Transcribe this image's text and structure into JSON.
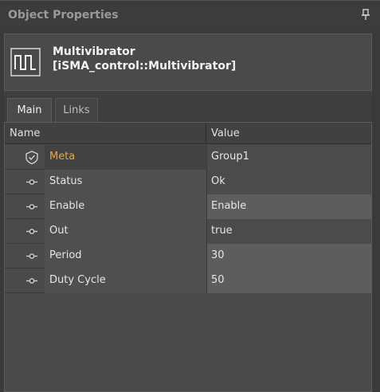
{
  "panel": {
    "title": "Object Properties",
    "pin_icon": "pin-icon"
  },
  "object": {
    "name": "Multivibrator",
    "type": "[iSMA_control::Multivibrator]",
    "icon": "multivibrator-icon"
  },
  "tabs": [
    {
      "label": "Main",
      "active": true
    },
    {
      "label": "Links",
      "active": false
    }
  ],
  "grid": {
    "columns": [
      "Name",
      "Value"
    ],
    "rows": [
      {
        "name": "Meta",
        "value": "Group1",
        "icon": "shield-icon"
      },
      {
        "name": "Status",
        "value": "Ok",
        "icon": "slot-icon"
      },
      {
        "name": "Enable",
        "value": "Enable",
        "icon": "slot-icon"
      },
      {
        "name": "Out",
        "value": "true",
        "icon": "slot-icon"
      },
      {
        "name": "Period",
        "value": "30",
        "icon": "slot-icon"
      },
      {
        "name": "Duty Cycle",
        "value": "50",
        "icon": "slot-icon"
      }
    ]
  },
  "colors": {
    "accent": "#f0a530",
    "background": "#3a3a3a"
  }
}
